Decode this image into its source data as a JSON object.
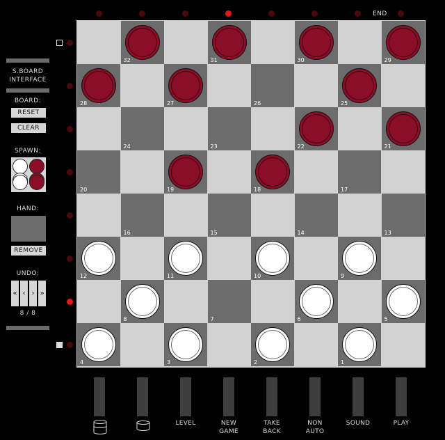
{
  "title": "S.BOARD\nINTERFACE",
  "board_label": "BOARD:",
  "reset_label": "RESET",
  "clear_label": "CLEAR",
  "spawn_label": "SPAWN:",
  "hand_label": "HAND:",
  "remove_label": "REMOVE",
  "undo_label": "UNDO:",
  "undo_buttons": [
    "«",
    "‹",
    "›",
    "»"
  ],
  "undo_count": "8 / 8",
  "end_label": "END",
  "top_leds": [
    false,
    false,
    false,
    true,
    false,
    false,
    false,
    false
  ],
  "left_leds": [
    false,
    false,
    false,
    false,
    false,
    false,
    true,
    false
  ],
  "board": {
    "squares": [
      {
        "n": "32",
        "p": "red"
      },
      {
        "n": "31",
        "p": "red"
      },
      {
        "n": "30",
        "p": "red"
      },
      {
        "n": "29",
        "p": "red"
      },
      {
        "n": "28",
        "p": "red"
      },
      {
        "n": "27",
        "p": "red"
      },
      {
        "n": "26",
        "p": ""
      },
      {
        "n": "25",
        "p": "red"
      },
      {
        "n": "24",
        "p": ""
      },
      {
        "n": "23",
        "p": ""
      },
      {
        "n": "22",
        "p": "red"
      },
      {
        "n": "21",
        "p": "red"
      },
      {
        "n": "20",
        "p": ""
      },
      {
        "n": "19",
        "p": "red"
      },
      {
        "n": "18",
        "p": "red"
      },
      {
        "n": "17",
        "p": ""
      },
      {
        "n": "16",
        "p": ""
      },
      {
        "n": "15",
        "p": ""
      },
      {
        "n": "14",
        "p": ""
      },
      {
        "n": "13",
        "p": ""
      },
      {
        "n": "12",
        "p": "white"
      },
      {
        "n": "11",
        "p": "white"
      },
      {
        "n": "10",
        "p": "white"
      },
      {
        "n": "9",
        "p": "white"
      },
      {
        "n": "8",
        "p": "white"
      },
      {
        "n": "7",
        "p": ""
      },
      {
        "n": "6",
        "p": "white"
      },
      {
        "n": "5",
        "p": "white"
      },
      {
        "n": "4",
        "p": "white"
      },
      {
        "n": "3",
        "p": "white"
      },
      {
        "n": "2",
        "p": "white"
      },
      {
        "n": "1",
        "p": "white"
      }
    ]
  },
  "bottom_buttons": [
    {
      "label": "",
      "icon": "cylinder-tall-icon"
    },
    {
      "label": "",
      "icon": "cylinder-short-icon"
    },
    {
      "label": "LEVEL"
    },
    {
      "label": "NEW\nGAME"
    },
    {
      "label": "TAKE\nBACK"
    },
    {
      "label": "NON\nAUTO"
    },
    {
      "label": "SOUND"
    },
    {
      "label": "PLAY"
    }
  ],
  "colors": {
    "red_piece": "#8a0e28",
    "white_piece": "#ffffff",
    "dark_square": "#6c6c6c",
    "light_square": "#d2d2d2",
    "led_on": "#e81818",
    "led_off": "#4a0a0a"
  }
}
